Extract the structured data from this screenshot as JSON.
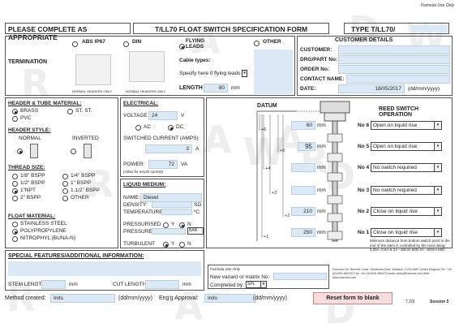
{
  "corner_note": "Fozmula Use Only",
  "header": {
    "instruction": "PLEASE COMPLETE AS APPROPRIATE",
    "title": "T/LL70 FLOAT SWITCH SPECIFICATION FORM",
    "type_label": "TYPE T/LL70/"
  },
  "termination": {
    "label": "TERMINATION",
    "abs": "ABS IP67",
    "din": "DIN",
    "flying": "FLYING LEADS",
    "other": "OTHER",
    "normal_headers_1": "NORMAL HEADERS ONLY",
    "normal_headers_2": "NORMAL HEADERS ONLY",
    "cable_types": "Cable types:",
    "specify": "Specify here if flying leads",
    "length_label": "LENGTH",
    "length_value": "80",
    "length_unit": "mm"
  },
  "customer": {
    "title": "CUSTOMER DETAILS",
    "customer": "CUSTOMER:",
    "drg": "DRG/PART No:",
    "order": "ORDER No:",
    "contact": "CONTACT NAME:",
    "date_label": "DATE:",
    "date_value": "18/05/2017",
    "date_fmt": "(dd/mm/yyyy)"
  },
  "header_tube": {
    "title": "HEADER & TUBE MATERIAL:",
    "brass": "BRASS",
    "stst": "ST. ST.",
    "pvc": "PVC"
  },
  "header_style": {
    "title": "HEADER STYLE:",
    "normal": "NORMAL",
    "inverted": "INVERTED"
  },
  "thread": {
    "title": "THREAD SIZE:",
    "o1": "1/8\" BSPP",
    "o2": "1/4\" BSPP",
    "o3": "1/2\" BSPP",
    "o4": "1\" BSPP",
    "o5": "1\"NPT",
    "o6": "1.1/2\" BSPP",
    "o7": "2\" BSPP",
    "o8": "OTHER"
  },
  "float": {
    "title": "FLOAT MATERIAL:",
    "o1": "STAINLESS STEEL",
    "o2": "POLYPROPYLENE",
    "o3": "NITROPHYL (BUNA-N)"
  },
  "electrical": {
    "title": "ELECTRICAL:",
    "voltage_label": "VOLTAGE",
    "voltage_value": "24",
    "voltage_unit": "V",
    "ac": "AC",
    "dc": "DC",
    "switched": "SWITCHED CURRENT (AMPS)",
    "current_value": "3",
    "current_unit": "A",
    "power_label": "POWER:",
    "power_value": "72",
    "power_unit": "VA",
    "inrush": "(Allow for inrush current)"
  },
  "liquid": {
    "title": "LIQUID MEDIUM:",
    "name_label": "NAME:",
    "name_value": "Diesel",
    "density_label": "DENSITY:",
    "density_unit": "SG",
    "temp_label": "TEMPERATURE:",
    "temp_unit": "ºC",
    "pressurised": "PRESSURISED",
    "y": "Y",
    "n": "N",
    "pressure_label": "PRESSURE:",
    "pressure_unit": "BAR",
    "turbulent": "TURBULENT"
  },
  "datum": {
    "label": "DATUM",
    "levels": [
      {
        "mark": "6",
        "value": "60",
        "unit": "mm"
      },
      {
        "mark": "5",
        "value": "95",
        "unit": "mm"
      },
      {
        "mark": "4",
        "value": "",
        "unit": "mm"
      },
      {
        "mark": "3",
        "value": "",
        "unit": "mm"
      },
      {
        "mark": "2",
        "value": "210",
        "unit": "mm"
      },
      {
        "mark": "1",
        "value": "250",
        "unit": "mm"
      }
    ]
  },
  "reed": {
    "title": "REED SWITCH OPERATION",
    "rows": [
      {
        "no": "No 6",
        "value": "Open on liquid rise"
      },
      {
        "no": "No 5",
        "value": "Open on liquid rise"
      },
      {
        "no": "No 4",
        "value": "No switch required"
      },
      {
        "no": "No 3",
        "value": "No switch required"
      },
      {
        "no": "No 2",
        "value": "Close on liquid rise"
      },
      {
        "no": "No 1",
        "value": "Close on liquid rise"
      }
    ],
    "note": "Minimum distance from bottom switch point to the end of the stem is controlled by the reed rating: 0.25A, 0.5A & 2A - 38mm MIN 3A - 60mm MIN"
  },
  "special": {
    "title": "SPECIAL FEATURES/ADDITIONAL INFORMATION:",
    "stem_label": "STEM LENGTH:",
    "stem_unit": "mm",
    "cut_label": "CUT LENGTH:",
    "cut_unit": "mm"
  },
  "fozmula_box": {
    "title": "Fozmula Use Only",
    "new_variant": "New variant or matrix No:",
    "completed": "Completed by:",
    "completed_value": "SPL"
  },
  "address": "Fozmula Ltd, Hermes Close, Tachbrook Park, Warwick, CV34 6NP, United Kingdom Tel: +44 (0)1926 466700 Fax: +44 (0)1926 450473 email: sales@fozmula.com Web: www.fozmula.com",
  "footer": {
    "method": "Method created:",
    "inits1": "Inits",
    "date_fmt1": "(dd/mm/yyyy)",
    "approval": "Eng'g Approval:",
    "inits2": "Inits",
    "date_fmt2": "(dd/mm/yyyy)",
    "reset": "Reset form to blank",
    "page_ref": "7.2/3",
    "session": "Session 5"
  },
  "watermarks": [
    "R",
    "A",
    "D",
    "W",
    "R",
    "A",
    "W",
    "A",
    "R",
    "D",
    "R",
    "A",
    "D"
  ]
}
